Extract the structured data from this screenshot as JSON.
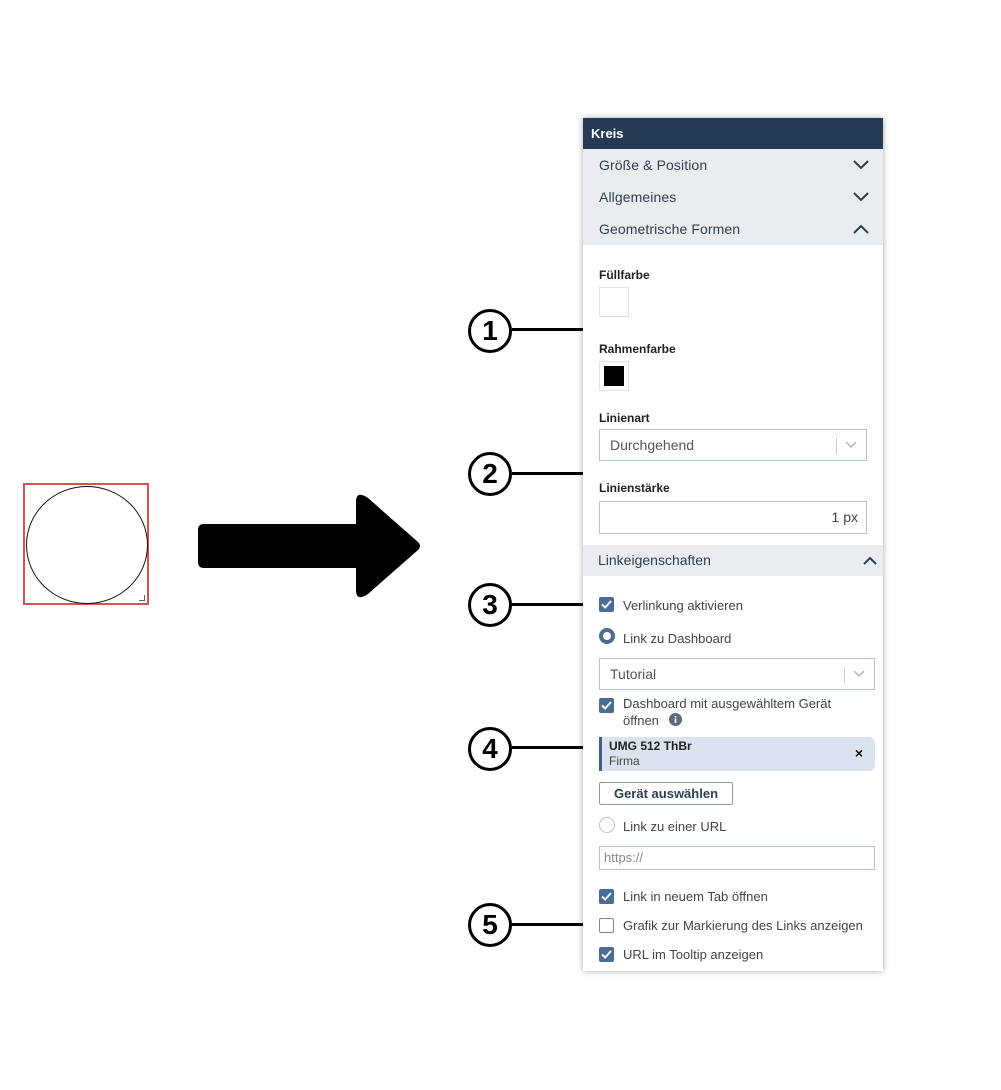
{
  "panel": {
    "title": "Kreis",
    "accordion": [
      {
        "label": "Größe & Position",
        "state": "collapsed"
      },
      {
        "label": "Allgemeines",
        "state": "collapsed"
      },
      {
        "label": "Geometrische Formen",
        "state": "expanded"
      }
    ],
    "geo": {
      "fill_label": "Füllfarbe",
      "fill_color": "#ffffff",
      "border_label": "Rahmenfarbe",
      "border_color": "#000000",
      "linestyle_label": "Linienart",
      "linestyle_value": "Durchgehend",
      "linewidth_label": "Linienstärke",
      "linewidth_value": "1 px"
    },
    "link": {
      "header": "Linkeigenschaften",
      "enable_label": "Verlinkung aktivieren",
      "dashboard_radio_label": "Link zu Dashboard",
      "dashboard_select_value": "Tutorial",
      "with_device_label_1": "Dashboard mit ausgewähltem Gerät",
      "with_device_label_2": "öffnen",
      "device_name": "UMG 512 ThBr",
      "device_company": "Firma",
      "device_remove": "×",
      "choose_device_button": "Gerät auswählen",
      "url_radio_label": "Link zu einer URL",
      "url_placeholder": "https://",
      "new_tab_label": "Link in neuem Tab öffnen",
      "marker_label": "Grafik zur Markierung des Links anzeigen",
      "tooltip_label": "URL im Tooltip anzeigen"
    }
  },
  "callouts": [
    "1",
    "2",
    "3",
    "4",
    "5"
  ],
  "colors": {
    "header_bg": "#243a55",
    "accent": "#4a6d96",
    "selection_border": "#d9534f"
  }
}
